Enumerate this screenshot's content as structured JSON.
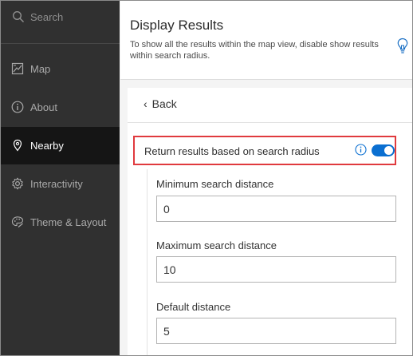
{
  "sidebar": {
    "search_label": "Search",
    "items": [
      {
        "label": "Map",
        "icon": "map-icon"
      },
      {
        "label": "About",
        "icon": "info-icon"
      },
      {
        "label": "Nearby",
        "icon": "location-pin-icon",
        "active": true
      },
      {
        "label": "Interactivity",
        "icon": "gear-icon"
      },
      {
        "label": "Theme & Layout",
        "icon": "palette-icon"
      }
    ]
  },
  "header": {
    "title": "Display Results",
    "description": "To show all the results within the map view, disable show results within search radius.",
    "tip_icon": "lightbulb-icon"
  },
  "panel": {
    "back_label": "Back",
    "toggle": {
      "label": "Return results based on search radius",
      "enabled": true
    },
    "fields": [
      {
        "label": "Minimum search distance",
        "value": "0"
      },
      {
        "label": "Maximum search distance",
        "value": "10"
      },
      {
        "label": "Default distance",
        "value": "5"
      }
    ]
  },
  "colors": {
    "sidebar_bg": "#303030",
    "sidebar_active_bg": "#151515",
    "accent": "#0a6fd1",
    "highlight_border": "#e03a3e"
  }
}
